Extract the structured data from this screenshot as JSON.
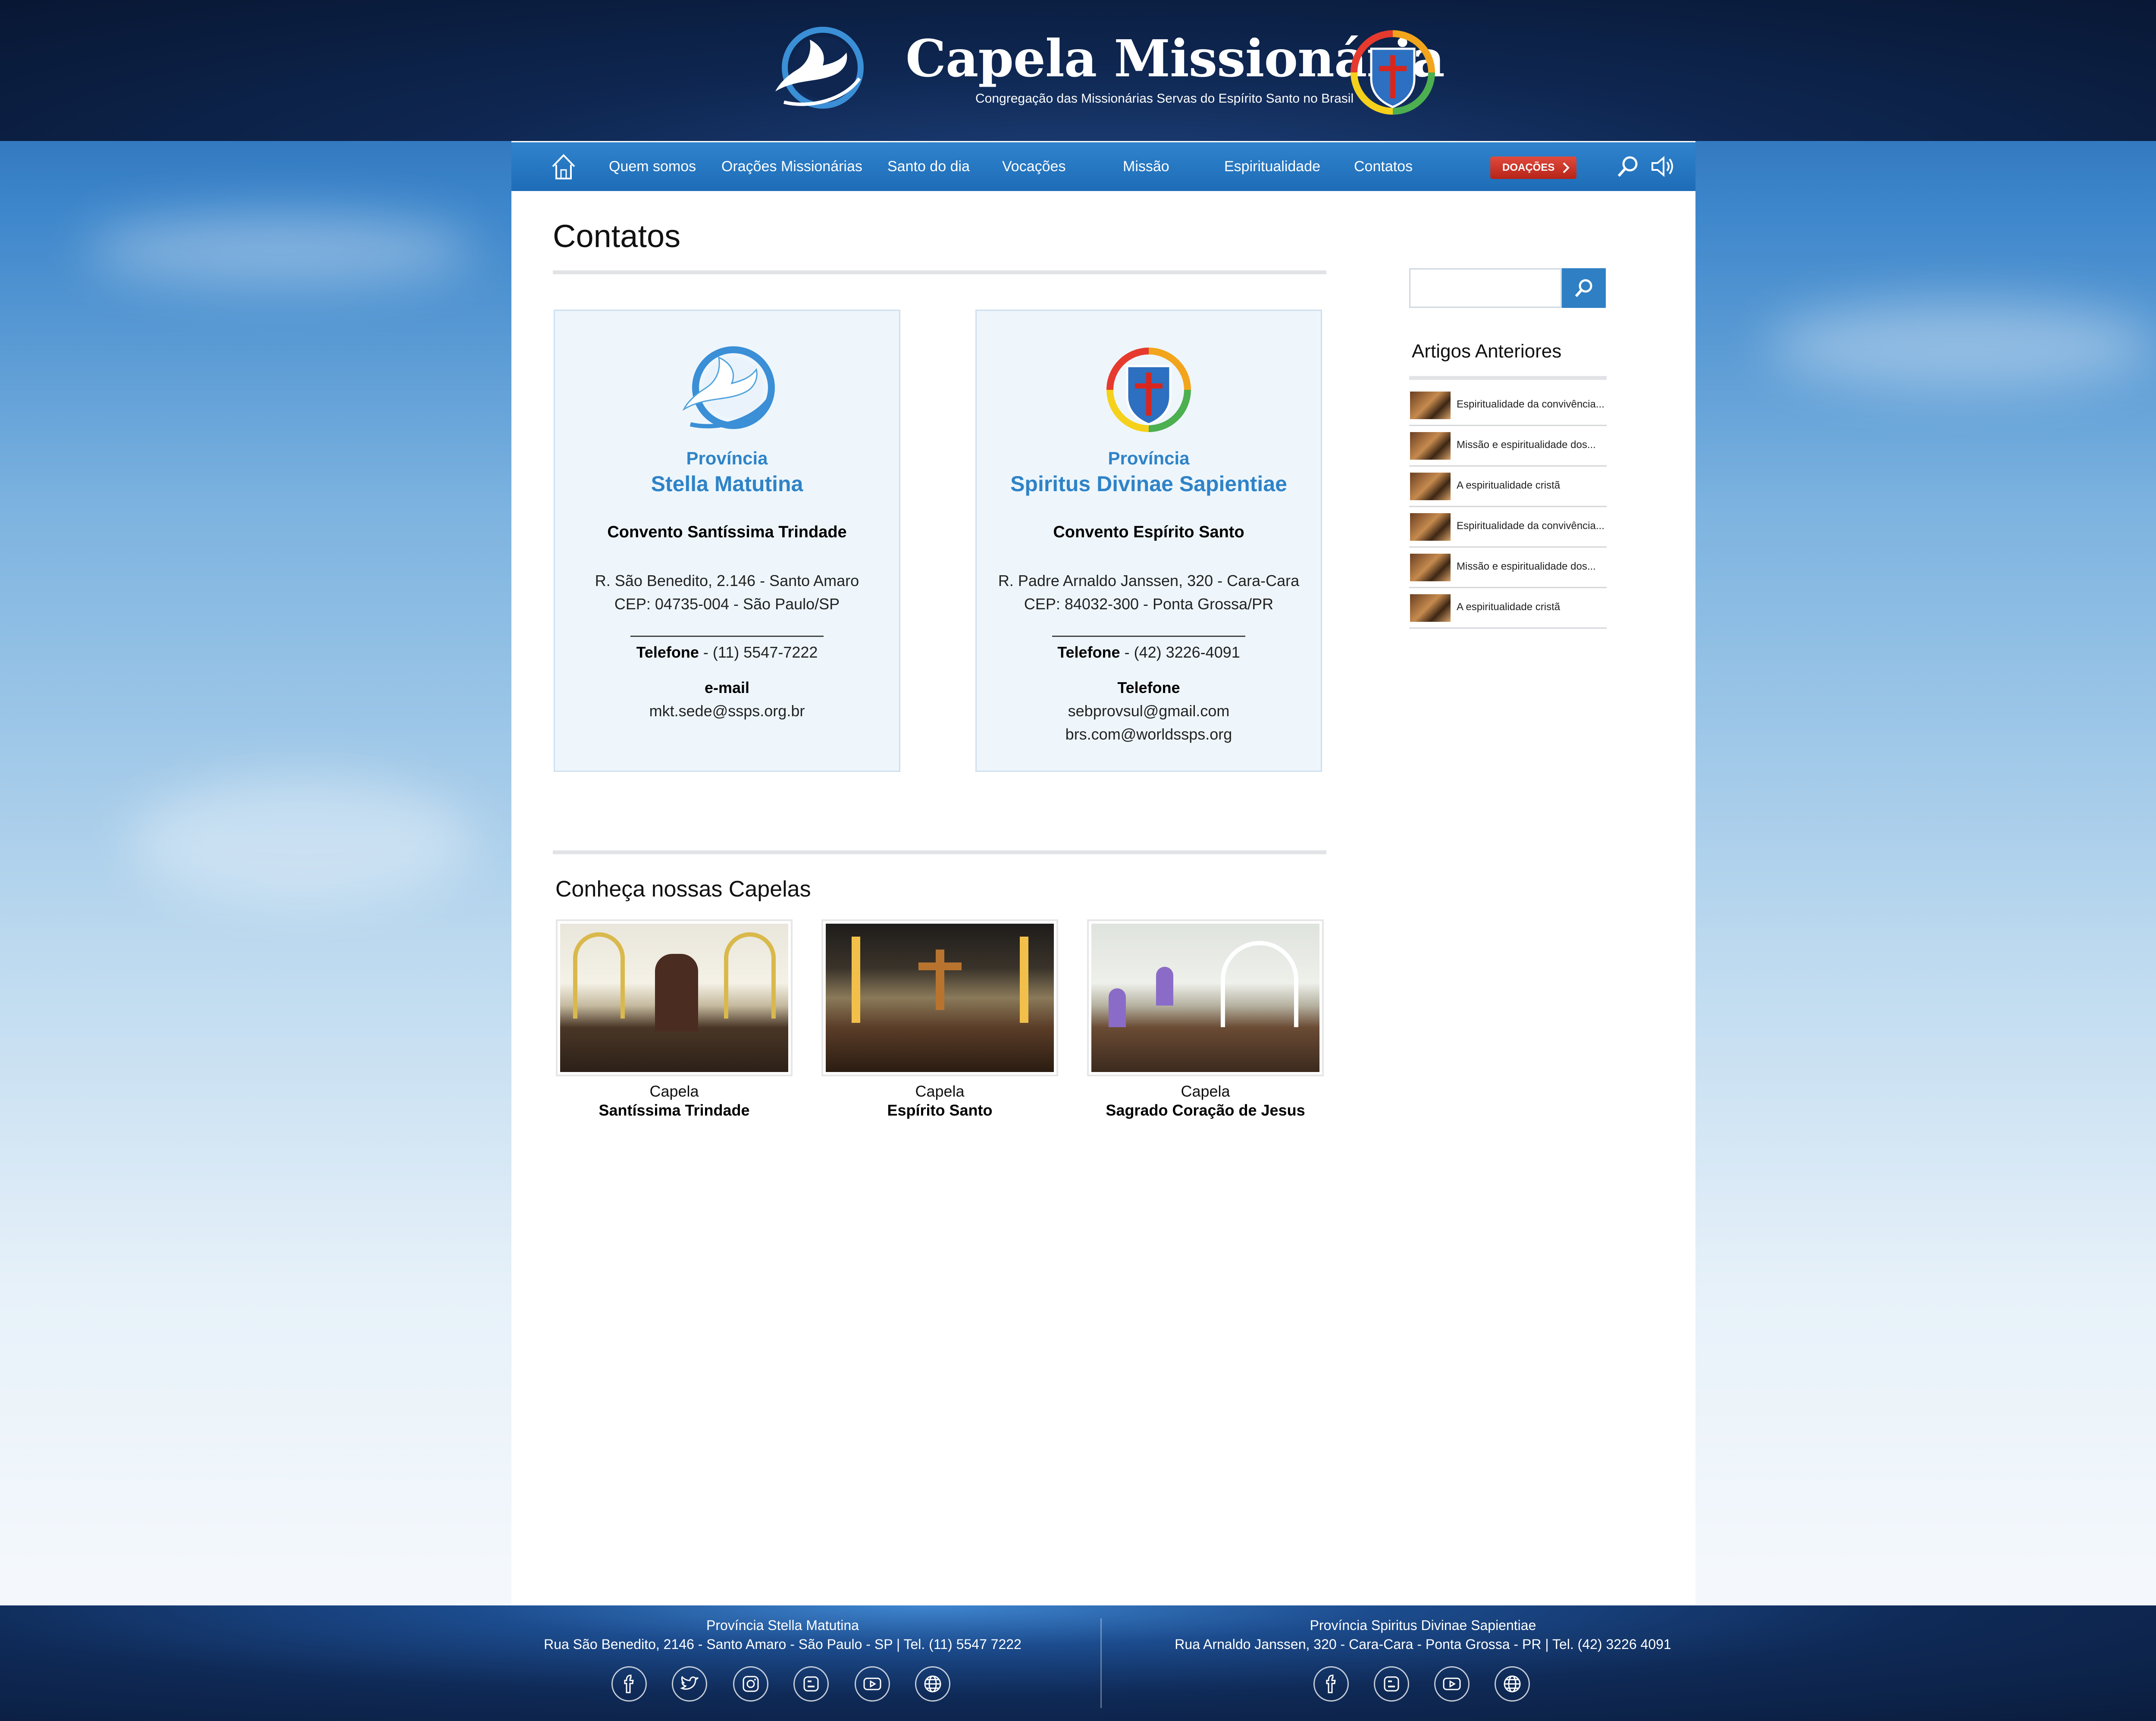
{
  "header": {
    "brand_title": "Capela Missionária",
    "brand_subtitle": "Congregação das Missionárias Servas do Espírito Santo no Brasil"
  },
  "nav": {
    "items": [
      "Quem somos",
      "Orações Missionárias",
      "Santo do dia",
      "Vocações",
      "Missão",
      "Espiritualidade",
      "Contatos"
    ],
    "donate_label": "DOAÇÕES"
  },
  "page": {
    "title": "Contatos"
  },
  "contacts": [
    {
      "label": "Província",
      "name": "Stella Matutina",
      "convent": "Convento Santíssima Trindade",
      "address_1": "R. São Benedito, 2.146 - Santo Amaro",
      "address_2": "CEP: 04735-004 - São Paulo/SP",
      "phone_label": "Telefone",
      "phone": " - (11) 5547-7222",
      "email_label": "e-mail",
      "email_1": "mkt.sede@ssps.org.br"
    },
    {
      "label": "Província",
      "name": "Spiritus Divinae Sapientiae",
      "convent": "Convento Espírito Santo",
      "address_1": "R. Padre Arnaldo Janssen, 320 - Cara-Cara",
      "address_2": "CEP: 84032-300 - Ponta Grossa/PR",
      "phone_label": "Telefone",
      "phone": " - (42) 3226-4091",
      "email_label": "Telefone",
      "email_1": "sebprovsul@gmail.com",
      "email_2": "brs.com@worldssps.org"
    }
  ],
  "chapels": {
    "title": "Conheça nossas Capelas",
    "items": [
      {
        "prefix": "Capela",
        "name": "Santíssima Trindade"
      },
      {
        "prefix": "Capela",
        "name": "Espírito Santo"
      },
      {
        "prefix": "Capela",
        "name": "Sagrado Coração de Jesus"
      }
    ]
  },
  "sidebar": {
    "title": "Artigos Anteriores",
    "articles": [
      "Espiritualidade da convivência...",
      "Missão e espiritualidade dos...",
      "A espiritualidade cristã",
      "Espiritualidade da convivência...",
      "Missão e espiritualidade dos...",
      "A espiritualidade cristã"
    ]
  },
  "footer": {
    "left_title": "Província Stella Matutina",
    "left_address": "Rua São Benedito, 2146 - Santo Amaro - São Paulo - SP | Tel. (11) 5547 7222",
    "right_title": "Província Spiritus Divinae Sapientiae",
    "right_address": "Rua Arnaldo Janssen, 320 - Cara-Cara - Ponta Grossa - PR | Tel. (42) 3226 4091",
    "left_icons": [
      "facebook-icon",
      "twitter-icon",
      "instagram-icon",
      "blogger-icon",
      "youtube-icon",
      "globe-icon"
    ],
    "right_icons": [
      "facebook-icon",
      "blogger-icon",
      "youtube-icon",
      "globe-icon"
    ]
  },
  "colors": {
    "accent_blue": "#2f83c7",
    "nav_blue": "#1e6cb7",
    "donate_red": "#c8332a",
    "header_navy": "#0e2650"
  }
}
